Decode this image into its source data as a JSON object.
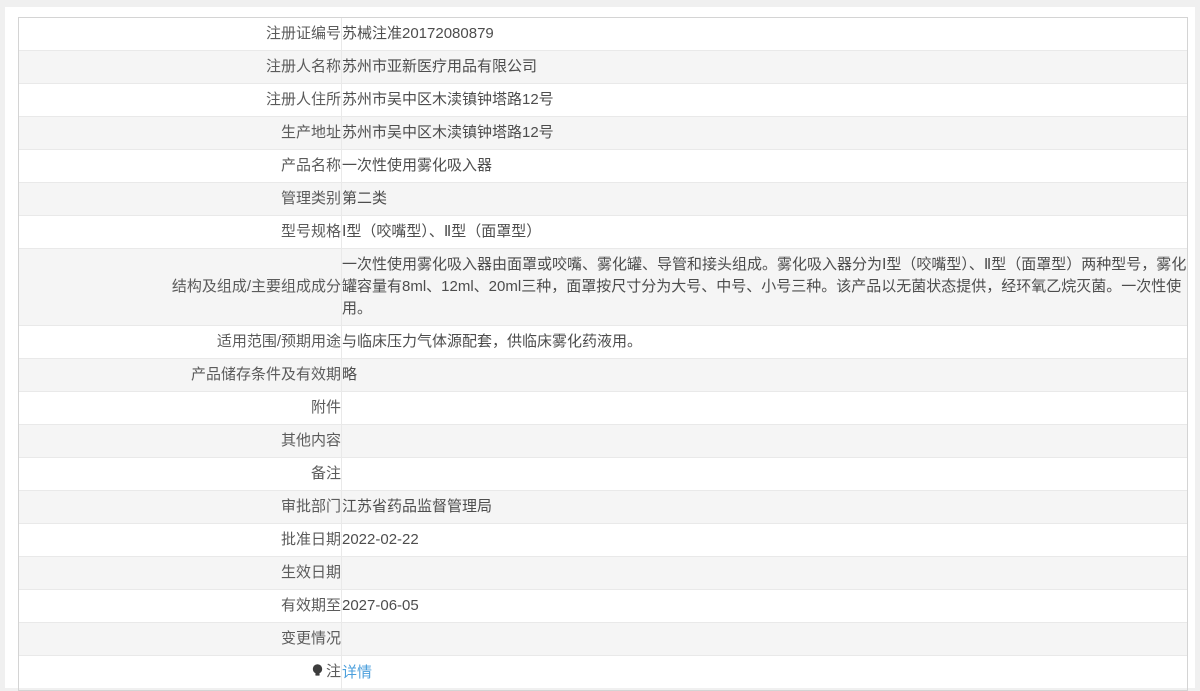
{
  "page": {
    "background": "#f0f0f0",
    "panel_background": "#ffffff"
  },
  "colors": {
    "row_alt_background": "#f5f5f5",
    "border_outer": "#d4d4d4",
    "border_inner": "#e9e9e9",
    "label_text": "#5b5b5b",
    "value_text": "#4d4d4d",
    "link": "#4b9fdc",
    "icon": "#3d3d3d"
  },
  "table": {
    "rows": [
      {
        "label": "注册证编号",
        "value": "苏械注准20172080879"
      },
      {
        "label": "注册人名称",
        "value": "苏州市亚新医疗用品有限公司"
      },
      {
        "label": "注册人住所",
        "value": "苏州市吴中区木渎镇钟塔路12号"
      },
      {
        "label": "生产地址",
        "value": "苏州市吴中区木渎镇钟塔路12号"
      },
      {
        "label": "产品名称",
        "value": "一次性使用雾化吸入器"
      },
      {
        "label": "管理类别",
        "value": "第二类"
      },
      {
        "label": "型号规格",
        "value": "Ⅰ型（咬嘴型）、Ⅱ型（面罩型）"
      },
      {
        "label": "结构及组成/主要组成成分",
        "value": "一次性使用雾化吸入器由面罩或咬嘴、雾化罐、导管和接头组成。雾化吸入器分为Ⅰ型（咬嘴型）、Ⅱ型（面罩型）两种型号，雾化罐容量有8ml、12ml、20ml三种，面罩按尺寸分为大号、中号、小号三种。该产品以无菌状态提供，经环氧乙烷灭菌。一次性使用。"
      },
      {
        "label": "适用范围/预期用途",
        "value": "与临床压力气体源配套，供临床雾化药液用。"
      },
      {
        "label": "产品储存条件及有效期",
        "value": "略"
      },
      {
        "label": "附件",
        "value": ""
      },
      {
        "label": "其他内容",
        "value": ""
      },
      {
        "label": "备注",
        "value": ""
      },
      {
        "label": "审批部门",
        "value": "江苏省药品监督管理局"
      },
      {
        "label": "批准日期",
        "value": "2022-02-22"
      },
      {
        "label": "生效日期",
        "value": ""
      },
      {
        "label": "有效期至",
        "value": "2027-06-05"
      },
      {
        "label": "变更情况",
        "value": ""
      },
      {
        "label": "注",
        "value": "详情",
        "icon": "lightbulb-icon"
      }
    ]
  }
}
